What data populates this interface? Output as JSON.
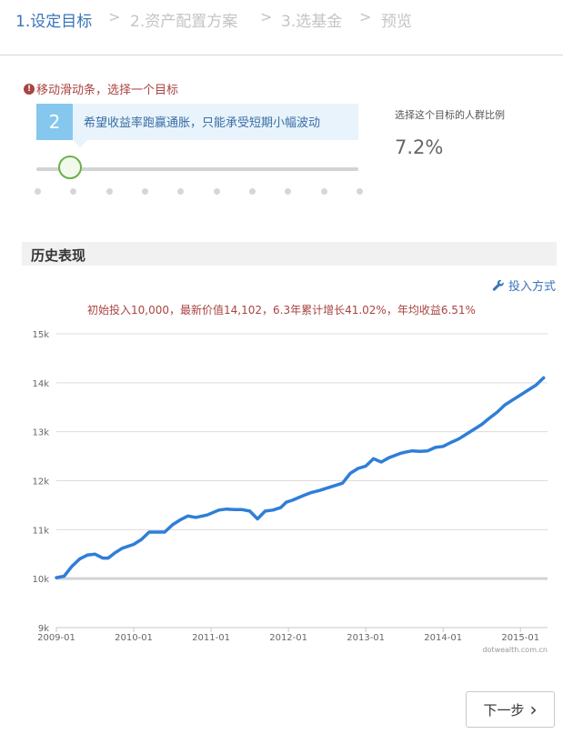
{
  "steps": [
    {
      "label": "1.设定目标",
      "active": true
    },
    {
      "label": "2.资产配置方案",
      "active": false
    },
    {
      "label": "3.选基金",
      "active": false
    },
    {
      "label": "预览",
      "active": false
    }
  ],
  "step_separator": ">",
  "goal": {
    "hint": "移动滑动条，选择一个目标",
    "hint_icon": "exclamation-icon",
    "selected_number": "2",
    "selected_text": "希望收益率跑赢通胀，只能承受短期小幅波动",
    "slider_position": 2,
    "slider_stops": 10,
    "population_label": "选择这个目标的人群比例",
    "population_value": "7.2%"
  },
  "history": {
    "title": "历史表现",
    "invest_link": "投入方式",
    "invest_icon": "wrench-icon",
    "summary": "初始投入10,000，最新价值14,102，6.3年累计增长41.02%，年均收益6.51%"
  },
  "chart_data": {
    "type": "line",
    "title": "",
    "xlabel": "",
    "ylabel": "",
    "ylim": [
      9000,
      15000
    ],
    "yticks": [
      "9k",
      "10k",
      "11k",
      "12k",
      "13k",
      "14k",
      "15k"
    ],
    "xticks": [
      "2009-01",
      "2010-01",
      "2011-01",
      "2012-01",
      "2013-01",
      "2014-01",
      "2015-01"
    ],
    "xrange": [
      2009.0,
      2015.35
    ],
    "grid": true,
    "watermark": "dotwealth.com.cn",
    "baseline": 10000,
    "baseline_color": "#d3d3d3",
    "series_color": "#2f7ed8",
    "series": [
      {
        "x": [
          2009.0,
          2009.1,
          2009.2,
          2009.3,
          2009.4,
          2009.5,
          2009.6,
          2009.67,
          2009.75,
          2009.85,
          2010.0,
          2010.1,
          2010.2,
          2010.3,
          2010.4,
          2010.5,
          2010.6,
          2010.7,
          2010.8,
          2010.95,
          2011.1,
          2011.2,
          2011.3,
          2011.4,
          2011.5,
          2011.6,
          2011.7,
          2011.8,
          2011.9,
          2011.97,
          2012.05,
          2012.2,
          2012.3,
          2012.4,
          2012.5,
          2012.6,
          2012.7,
          2012.8,
          2012.9,
          2013.0,
          2013.1,
          2013.2,
          2013.3,
          2013.4,
          2013.45,
          2013.5,
          2013.6,
          2013.7,
          2013.8,
          2013.9,
          2014.0,
          2014.1,
          2014.2,
          2014.3,
          2014.4,
          2014.5,
          2014.6,
          2014.7,
          2014.8,
          2014.9,
          2015.0,
          2015.1,
          2015.2,
          2015.3
        ],
        "values": [
          10020,
          10050,
          10250,
          10400,
          10480,
          10500,
          10420,
          10420,
          10520,
          10620,
          10700,
          10800,
          10950,
          10950,
          10950,
          11100,
          11200,
          11280,
          11250,
          11300,
          11400,
          11420,
          11410,
          11410,
          11380,
          11220,
          11380,
          11400,
          11450,
          11560,
          11600,
          11700,
          11760,
          11800,
          11850,
          11900,
          11950,
          12150,
          12250,
          12300,
          12450,
          12380,
          12470,
          12530,
          12560,
          12580,
          12610,
          12600,
          12610,
          12680,
          12700,
          12780,
          12850,
          12950,
          13050,
          13150,
          13280,
          13400,
          13550,
          13650,
          13750,
          13850,
          13950,
          14100
        ]
      }
    ]
  },
  "next_button": "下一步"
}
